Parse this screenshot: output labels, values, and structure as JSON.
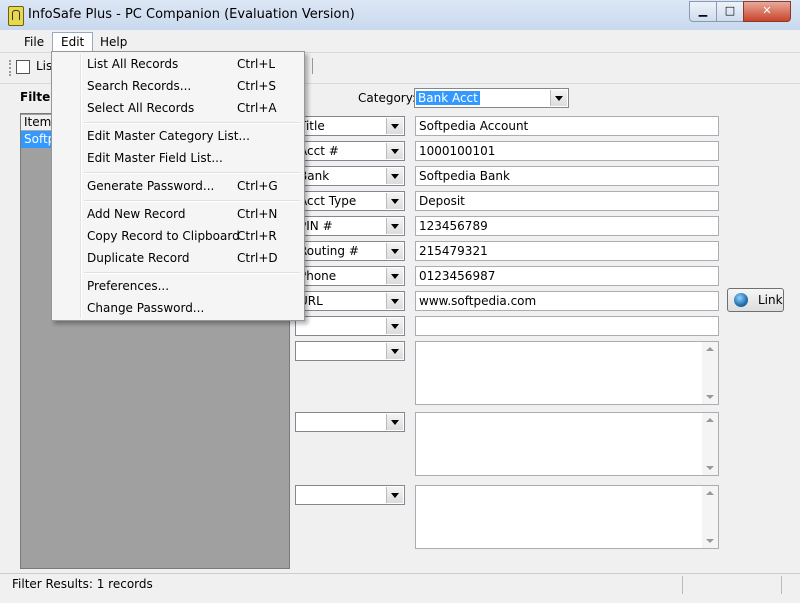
{
  "window": {
    "title": "InfoSafe Plus - PC Companion (Evaluation Version)"
  },
  "menubar": {
    "file": "File",
    "edit": "Edit",
    "help": "Help"
  },
  "toolbar": {
    "list_label": "List"
  },
  "filter": {
    "label": "Filter:"
  },
  "list": {
    "header": "Item",
    "rows": [
      "Softpedia"
    ]
  },
  "form": {
    "category_label": "Category:",
    "category_value": "Bank Acct",
    "fields": [
      {
        "name": "Title",
        "value": "Softpedia Account"
      },
      {
        "name": "Acct #",
        "value": "1000100101"
      },
      {
        "name": "Bank",
        "value": "Softpedia Bank"
      },
      {
        "name": "Acct Type",
        "value": "Deposit"
      },
      {
        "name": "PIN #",
        "value": "123456789"
      },
      {
        "name": "Routing #",
        "value": "215479321"
      },
      {
        "name": "Phone",
        "value": "0123456987"
      },
      {
        "name": "URL",
        "value": "www.softpedia.com"
      },
      {
        "name": "",
        "value": ""
      }
    ],
    "link_label": "Link"
  },
  "edit_menu": {
    "items": [
      {
        "label": "List All Records",
        "shortcut": "Ctrl+L"
      },
      {
        "label": "Search Records...",
        "shortcut": "Ctrl+S"
      },
      {
        "label": "Select All Records",
        "shortcut": "Ctrl+A"
      },
      {
        "label": "Edit Master Category List...",
        "shortcut": ""
      },
      {
        "label": "Edit Master Field List...",
        "shortcut": ""
      },
      {
        "label": "Generate Password...",
        "shortcut": "Ctrl+G"
      },
      {
        "label": "Add New Record",
        "shortcut": "Ctrl+N"
      },
      {
        "label": "Copy Record to Clipboard",
        "shortcut": "Ctrl+R"
      },
      {
        "label": "Duplicate Record",
        "shortcut": "Ctrl+D"
      },
      {
        "label": "Preferences...",
        "shortcut": ""
      },
      {
        "label": "Change Password...",
        "shortcut": ""
      }
    ]
  },
  "status": {
    "text": "Filter Results: 1 records"
  }
}
